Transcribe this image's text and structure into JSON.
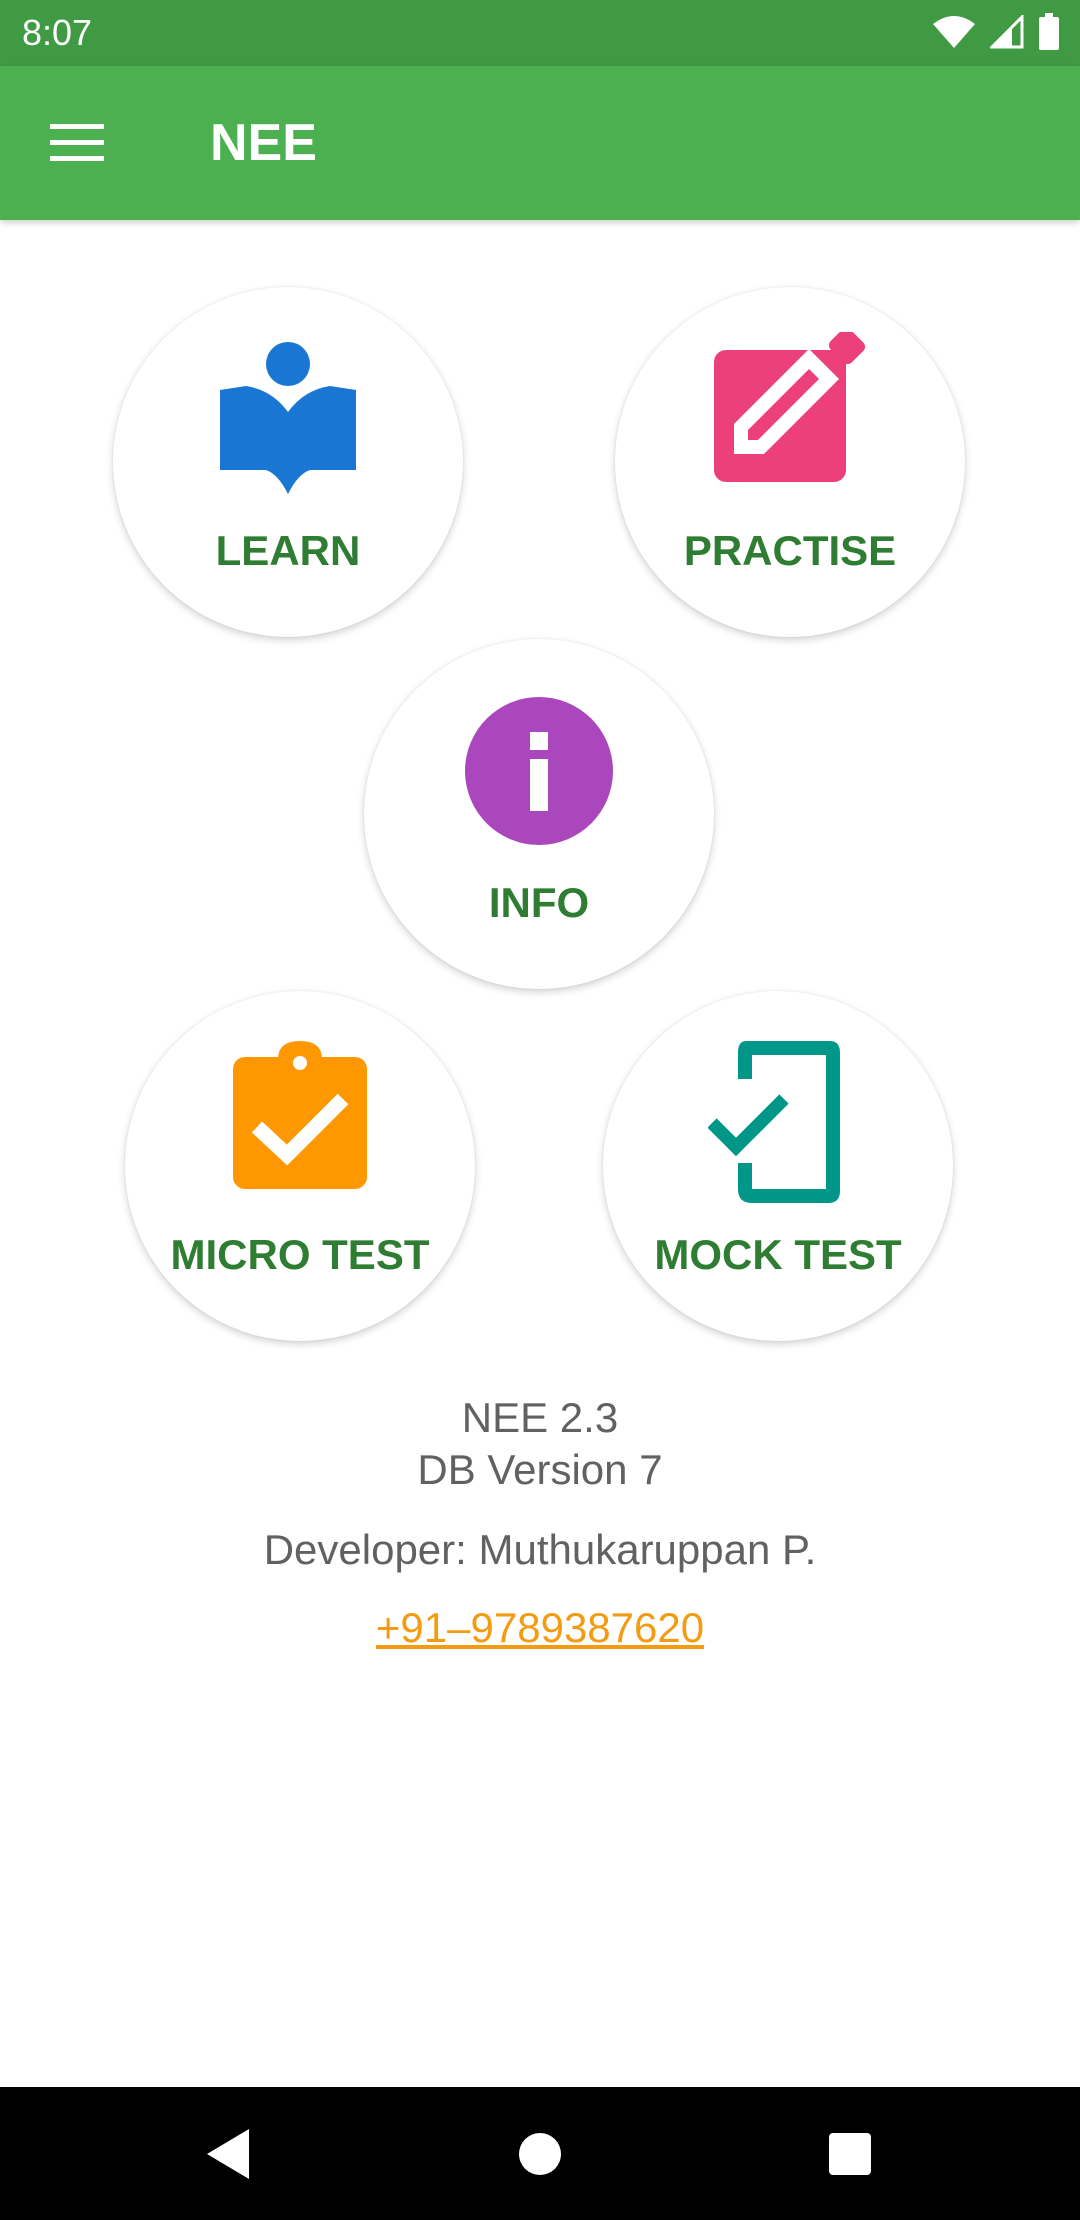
{
  "status_bar": {
    "time": "8:07",
    "icons": [
      "wifi-icon",
      "signal-icon",
      "battery-icon"
    ]
  },
  "app_bar": {
    "title": "NEE",
    "menu_icon": "menu-icon",
    "background": "#4caf50"
  },
  "tiles": {
    "learn": {
      "label": "LEARN",
      "icon": "book-reader-icon",
      "color": "#1976d2"
    },
    "practise": {
      "label": "PRACTISE",
      "icon": "edit-icon",
      "color": "#ec407a"
    },
    "info": {
      "label": "INFO",
      "icon": "info-icon",
      "color": "#ab47bc"
    },
    "micro_test": {
      "label": "MICRO TEST",
      "icon": "clipboard-check-icon",
      "color": "#ff9800"
    },
    "mock_test": {
      "label": "MOCK TEST",
      "icon": "phone-check-icon",
      "color": "#009688"
    }
  },
  "about": {
    "version": "NEE 2.3",
    "db_version": "DB Version 7",
    "developer": "Developer: Muthukaruppan P.",
    "phone": "+91–9789387620"
  },
  "nav_bar": {
    "icons": [
      "back-icon",
      "home-icon",
      "recents-icon"
    ]
  }
}
